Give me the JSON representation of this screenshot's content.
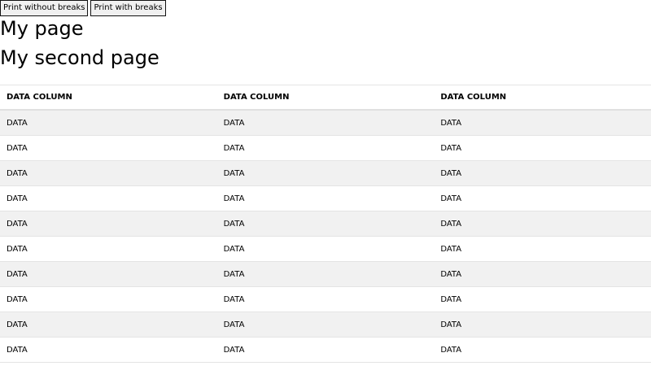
{
  "toolbar": {
    "print_without_breaks_label": "Print without breaks",
    "print_with_breaks_label": "Print with breaks"
  },
  "headings": {
    "first": "My page",
    "second": "My second page"
  },
  "table": {
    "columns": [
      "DATA COLUMN",
      "DATA COLUMN",
      "DATA COLUMN"
    ],
    "rows": [
      [
        "DATA",
        "DATA",
        "DATA"
      ],
      [
        "DATA",
        "DATA",
        "DATA"
      ],
      [
        "DATA",
        "DATA",
        "DATA"
      ],
      [
        "DATA",
        "DATA",
        "DATA"
      ],
      [
        "DATA",
        "DATA",
        "DATA"
      ],
      [
        "DATA",
        "DATA",
        "DATA"
      ],
      [
        "DATA",
        "DATA",
        "DATA"
      ],
      [
        "DATA",
        "DATA",
        "DATA"
      ],
      [
        "DATA",
        "DATA",
        "DATA"
      ],
      [
        "DATA",
        "DATA",
        "DATA"
      ]
    ]
  },
  "colors": {
    "row_stripe": "#f1f1f1",
    "row_border": "#e4e4e4"
  }
}
